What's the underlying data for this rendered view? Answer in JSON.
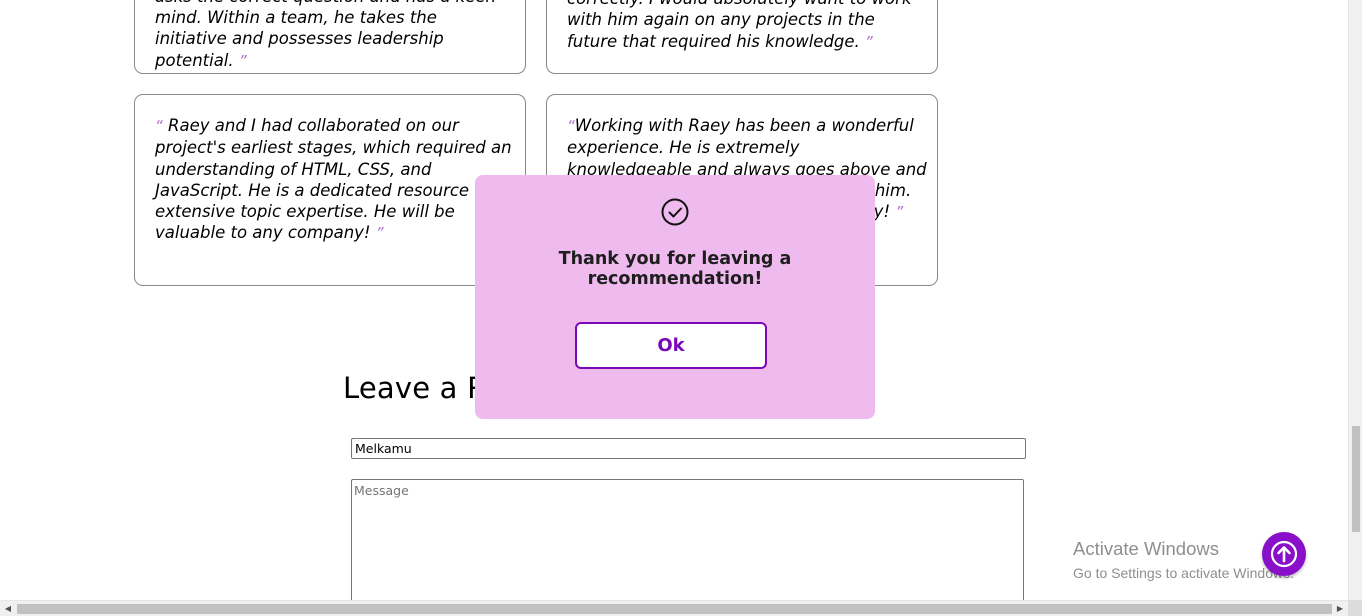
{
  "testimonials": [
    {
      "open_quote": "",
      "text": "asks the correct question and has a keen mind. Within a team, he takes the initiative and possesses leadership potential.",
      "close_quote": "”"
    },
    {
      "open_quote": "",
      "text": "correctly. I would absolutely want to work with him again on any projects in the future that required his knowledge.",
      "close_quote": "”"
    },
    {
      "open_quote": "“",
      "text": "Raey and I had collaborated on our project's earliest stages, which required an understanding of HTML, CSS, and JavaScript. He is a dedicated resource with extensive topic expertise. He will be valuable to any company!",
      "close_quote": "”"
    },
    {
      "open_quote": "“",
      "text": "Working with Raey has been a wonderful experience. He is extremely knowledgeable and always goes above and beyond to help out everyone around him. He would be an asset to any company!",
      "close_quote": "”"
    }
  ],
  "form": {
    "title": "Leave a Recommendation",
    "name_value": "Melkamu",
    "message_placeholder": "Message"
  },
  "modal": {
    "message": "Thank you for leaving a recommendation!",
    "ok_label": "Ok",
    "icon": "check-circle-icon"
  },
  "watermark": {
    "title": "Activate Windows",
    "subtitle": "Go to Settings to activate Windows."
  },
  "back_to_top": {
    "icon": "arrow-up-icon"
  },
  "colors": {
    "accent": "#8a0fc9",
    "modal_bg": "#efbbee",
    "quote_mark": "#b06ad0"
  }
}
